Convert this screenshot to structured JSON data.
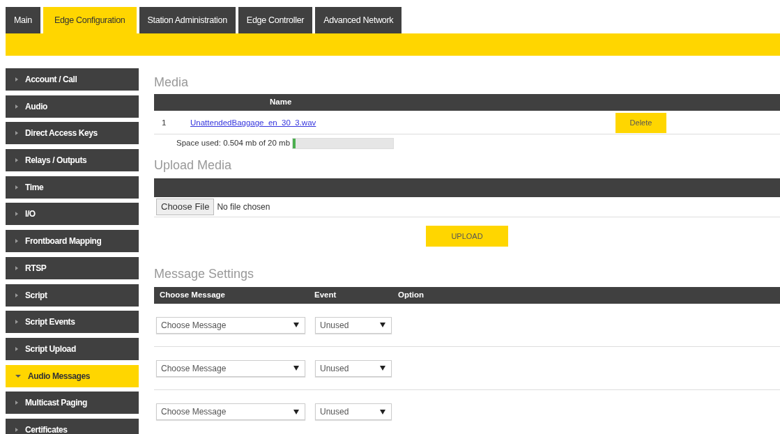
{
  "tabs": [
    {
      "label": "Main",
      "selected": false
    },
    {
      "label": "Edge Configuration",
      "selected": true
    },
    {
      "label": "Station Administration",
      "selected": false
    },
    {
      "label": "Edge Controller",
      "selected": false
    },
    {
      "label": "Advanced Network",
      "selected": false
    }
  ],
  "sidebar": {
    "items": [
      {
        "label": "Account / Call",
        "selected": false
      },
      {
        "label": "Audio",
        "selected": false
      },
      {
        "label": "Direct Access Keys",
        "selected": false
      },
      {
        "label": "Relays / Outputs",
        "selected": false
      },
      {
        "label": "Time",
        "selected": false
      },
      {
        "label": "I/O",
        "selected": false
      },
      {
        "label": "Frontboard Mapping",
        "selected": false
      },
      {
        "label": "RTSP",
        "selected": false
      },
      {
        "label": "Script",
        "selected": false
      },
      {
        "label": "Script Events",
        "selected": false
      },
      {
        "label": "Script Upload",
        "selected": false
      },
      {
        "label": "Audio Messages",
        "selected": true
      },
      {
        "label": "Multicast Paging",
        "selected": false
      },
      {
        "label": "Certificates",
        "selected": false
      }
    ]
  },
  "media": {
    "title": "Media",
    "columns": [
      "Name"
    ],
    "rows": [
      {
        "index": "1",
        "file": "UnattendedBaggage_en_30_3.wav",
        "action": "Delete"
      }
    ],
    "space_used": {
      "text": "Space used: 0.504 mb of 20 mb",
      "level": 0.025
    }
  },
  "upload": {
    "title": "Upload Media",
    "file_button": "Choose File",
    "file_status": "No file chosen",
    "button": "UPLOAD"
  },
  "message_settings": {
    "title": "Message Settings",
    "columns": [
      "Choose Message",
      "Event",
      "Option"
    ],
    "rows": [
      {
        "message": "Choose Message",
        "event": "Unused"
      },
      {
        "message": "Choose Message",
        "event": "Unused"
      },
      {
        "message": "Choose Message",
        "event": "Unused"
      }
    ]
  }
}
